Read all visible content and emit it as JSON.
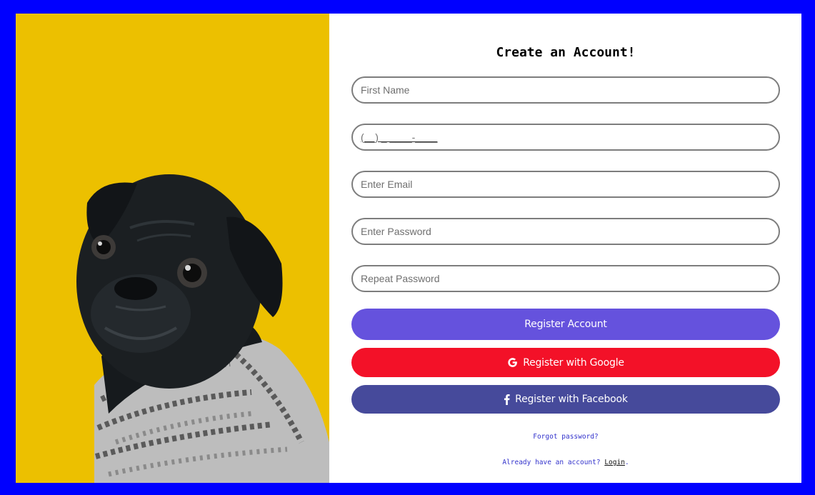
{
  "form": {
    "title": "Create an Account!",
    "first_name_placeholder": "First Name",
    "phone_placeholder": "(__) _ ____-____",
    "email_placeholder": "Enter Email",
    "password_placeholder": "Enter Password",
    "repeat_password_placeholder": "Repeat Password",
    "register_button": "Register Account",
    "google_button": "Register with Google",
    "facebook_button": "Register with Facebook",
    "forgot_password": "Forgot password?",
    "have_account_prefix": "Already have an account?",
    "login_link": "Login",
    "have_account_suffix": "."
  },
  "icons": {
    "google": "google-icon",
    "facebook": "facebook-icon"
  },
  "colors": {
    "page_background": "#0000ff",
    "photo_background": "#ecc000",
    "register": "#6552dd",
    "google": "#f31128",
    "facebook": "#464a9b"
  }
}
